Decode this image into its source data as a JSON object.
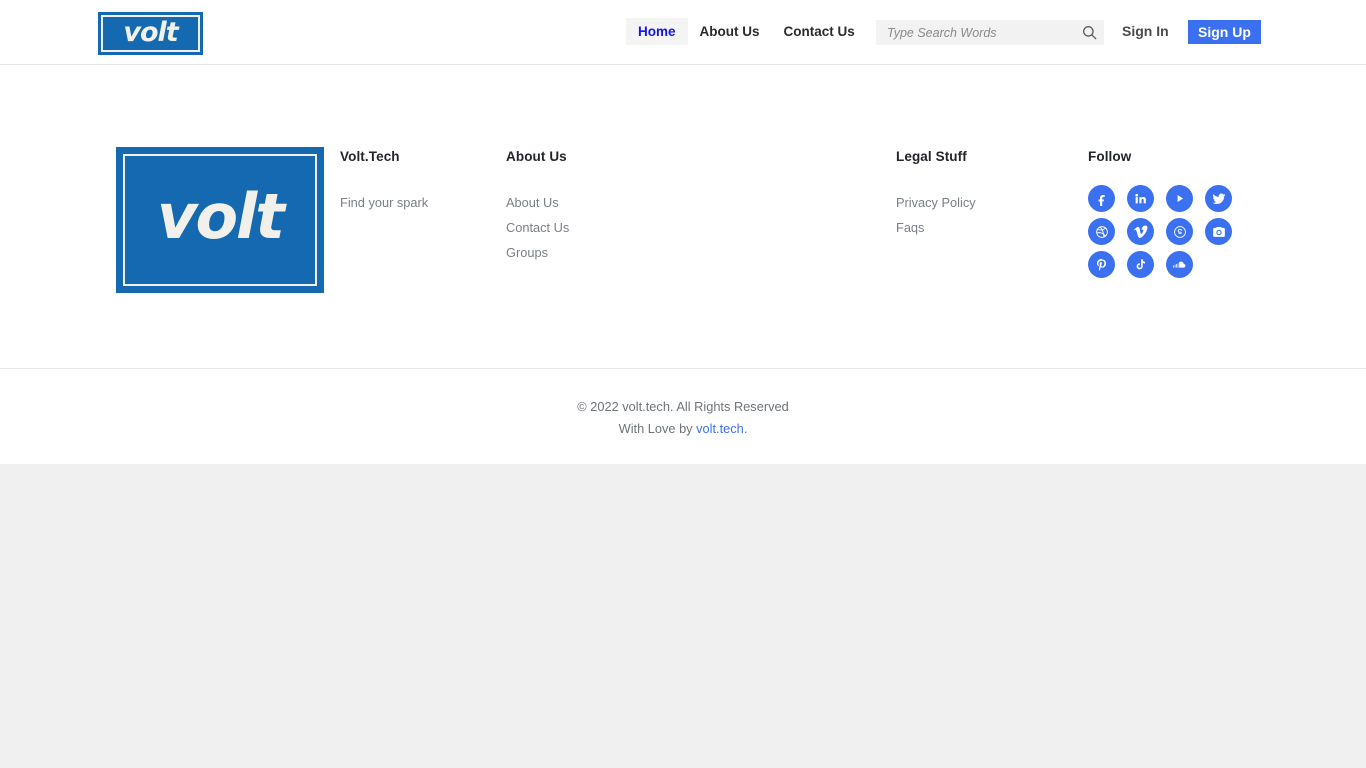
{
  "header": {
    "logo": {
      "text": "volt",
      "box_color": "#1469b0",
      "frame_color": "#f2f0ea"
    },
    "nav": [
      {
        "label": "Home",
        "active": true
      },
      {
        "label": "About Us",
        "active": false
      },
      {
        "label": "Contact Us",
        "active": false
      }
    ],
    "search": {
      "placeholder": "Type Search Words",
      "value": "",
      "icon": "search-icon"
    },
    "sign_in_label": "Sign In",
    "sign_up_label": "Sign Up",
    "active_link_color": "#1414f0",
    "signup_bg_color": "#3b71f0"
  },
  "footer": {
    "logo": {
      "text": "volt"
    },
    "columns": {
      "brand": {
        "title": "Volt.Tech",
        "tagline": "Find your spark"
      },
      "about": {
        "title": "About Us",
        "links": [
          "About Us",
          "Contact Us",
          "Groups"
        ]
      },
      "legal": {
        "title": "Legal Stuff",
        "links": [
          "Privacy Policy",
          "Faqs"
        ]
      },
      "follow": {
        "title": "Follow",
        "socials": [
          "facebook-icon",
          "linkedin-icon",
          "youtube-icon",
          "twitter-icon",
          "dribbble-icon",
          "vimeo-icon",
          "skype-icon",
          "instagram-icon",
          "pinterest-icon",
          "tiktok-icon",
          "soundcloud-icon"
        ],
        "icon_bg_color": "#3b71f0"
      }
    },
    "copyright_line1": "© 2022 volt.tech. All Rights Reserved",
    "copyright_line2_prefix": "With Love by ",
    "copyright_link": "volt.tech",
    "copyright_line2_suffix": ".",
    "link_color": "#3b71f0"
  }
}
